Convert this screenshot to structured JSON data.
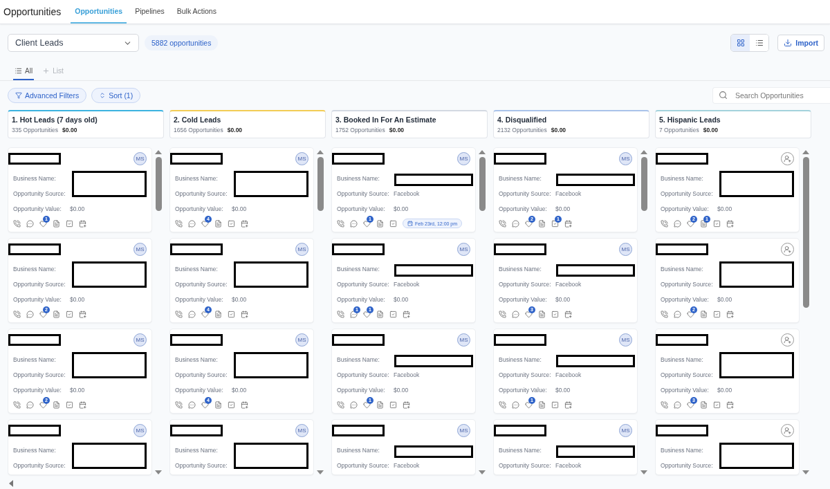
{
  "header": {
    "title": "Opportunities",
    "tabs": [
      {
        "label": "Opportunities",
        "selected": true
      },
      {
        "label": "Pipelines",
        "selected": false
      },
      {
        "label": "Bulk Actions",
        "selected": false
      }
    ]
  },
  "pipeline_select": {
    "value": "Client Leads"
  },
  "count_badge": "5882 opportunities",
  "view_toggle": [
    {
      "kind": "grid",
      "selected": true
    },
    {
      "kind": "list",
      "selected": false
    }
  ],
  "import_button": "Import",
  "list_tabs": [
    {
      "kind": "all",
      "label": "All",
      "selected": true
    },
    {
      "kind": "add",
      "label": "List",
      "selected": false
    }
  ],
  "filters": [
    {
      "kind": "filter",
      "label": "Advanced Filters"
    },
    {
      "kind": "sort",
      "label": "Sort (1)"
    }
  ],
  "search": {
    "placeholder": "Search Opportunities"
  },
  "columns": [
    {
      "title": "1. Hot Leads (7 days old)",
      "count": "335 Opportunities",
      "value": "$0.00",
      "color": "#3bb3e0",
      "cards": [
        {
          "avatar": {
            "kind": "initials",
            "text": "MS"
          },
          "fields": [
            {
              "label": "Business Name:"
            },
            {
              "label": "Opportunity Source:"
            },
            {
              "label": "Opportunity Value:",
              "value": "$0.00"
            }
          ],
          "badges": {
            "opportunity": "1"
          }
        },
        {
          "avatar": {
            "kind": "initials",
            "text": "MS"
          },
          "fields": [
            {
              "label": "Business Name:"
            },
            {
              "label": "Opportunity Source:"
            },
            {
              "label": "Opportunity Value:",
              "value": "$0.00"
            }
          ],
          "badges": {
            "opportunity": "2"
          }
        },
        {
          "avatar": {
            "kind": "initials",
            "text": "MS"
          },
          "fields": [
            {
              "label": "Business Name:"
            },
            {
              "label": "Opportunity Source:"
            },
            {
              "label": "Opportunity Value:",
              "value": "$0.00"
            }
          ],
          "badges": {
            "opportunity": "2"
          }
        },
        {
          "avatar": {
            "kind": "initials",
            "text": "MS"
          },
          "fields": [
            {
              "label": "Business Name:"
            },
            {
              "label": "Opportunity Source:"
            }
          ]
        }
      ]
    },
    {
      "title": "2. Cold Leads",
      "count": "1656 Opportunities",
      "value": "$0.00",
      "color": "#f2cc55",
      "cards": [
        {
          "avatar": {
            "kind": "initials",
            "text": "MS"
          },
          "fields": [
            {
              "label": "Business Name:"
            },
            {
              "label": "Opportunity Source:"
            },
            {
              "label": "Opportunity Value:",
              "value": "$0.00"
            }
          ],
          "badges": {
            "opportunity": "4"
          }
        },
        {
          "avatar": {
            "kind": "initials",
            "text": "MS"
          },
          "fields": [
            {
              "label": "Business Name:"
            },
            {
              "label": "Opportunity Source:"
            },
            {
              "label": "Opportunity Value:",
              "value": "$0.00"
            }
          ],
          "badges": {
            "opportunity": "4"
          }
        },
        {
          "avatar": {
            "kind": "initials",
            "text": "MS"
          },
          "fields": [
            {
              "label": "Business Name:"
            },
            {
              "label": "Opportunity Source:"
            },
            {
              "label": "Opportunity Value:",
              "value": "$0.00"
            }
          ],
          "badges": {
            "opportunity": "4"
          }
        },
        {
          "avatar": {
            "kind": "initials",
            "text": "MS"
          },
          "fields": [
            {
              "label": "Business Name:"
            },
            {
              "label": "Opportunity Source:"
            }
          ]
        }
      ]
    },
    {
      "title": "3. Booked In For An Estimate",
      "count": "1752 Opportunities",
      "value": "$0.00",
      "color": "#d3d9e2",
      "cards": [
        {
          "avatar": {
            "kind": "initials",
            "text": "MS"
          },
          "fields": [
            {
              "label": "Business Name:"
            },
            {
              "label": "Opportunity Source:",
              "value": "Facebook"
            },
            {
              "label": "Opportunity Value:",
              "value": "$0.00"
            }
          ],
          "badges": {
            "opportunity": "1"
          },
          "appointment": "Feb 23rd, 12:00 pm"
        },
        {
          "avatar": {
            "kind": "initials",
            "text": "MS"
          },
          "fields": [
            {
              "label": "Business Name:"
            },
            {
              "label": "Opportunity Source:",
              "value": "Facebook"
            },
            {
              "label": "Opportunity Value:",
              "value": "$0.00"
            }
          ],
          "badges": {
            "sms": "1",
            "opportunity": "1"
          }
        },
        {
          "avatar": {
            "kind": "initials",
            "text": "MS"
          },
          "fields": [
            {
              "label": "Business Name:"
            },
            {
              "label": "Opportunity Source:",
              "value": "Facebook"
            },
            {
              "label": "Opportunity Value:",
              "value": "$0.00"
            }
          ],
          "badges": {
            "opportunity": "1"
          }
        },
        {
          "avatar": {
            "kind": "initials",
            "text": "MS"
          },
          "fields": [
            {
              "label": "Business Name:"
            },
            {
              "label": "Opportunity Source:",
              "value": "Facebook"
            }
          ]
        }
      ]
    },
    {
      "title": "4. Disqualified",
      "count": "2132 Opportunities",
      "value": "$0.00",
      "color": "#a9c2ea",
      "cards": [
        {
          "avatar": {
            "kind": "initials",
            "text": "MS"
          },
          "fields": [
            {
              "label": "Business Name:"
            },
            {
              "label": "Opportunity Source:",
              "value": "Facebook"
            },
            {
              "label": "Opportunity Value:",
              "value": "$0.00"
            }
          ],
          "badges": {
            "opportunity": "2",
            "task": "1"
          }
        },
        {
          "avatar": {
            "kind": "initials",
            "text": "MS"
          },
          "fields": [
            {
              "label": "Business Name:"
            },
            {
              "label": "Opportunity Source:",
              "value": "Facebook"
            },
            {
              "label": "Opportunity Value:",
              "value": "$0.00"
            }
          ],
          "badges": {
            "opportunity": "3"
          }
        },
        {
          "avatar": {
            "kind": "initials",
            "text": "MS"
          },
          "fields": [
            {
              "label": "Business Name:"
            },
            {
              "label": "Opportunity Source:",
              "value": "Facebook"
            },
            {
              "label": "Opportunity Value:",
              "value": "$0.00"
            }
          ],
          "badges": {
            "opportunity": "1"
          }
        },
        {
          "avatar": {
            "kind": "initials",
            "text": "MS"
          },
          "fields": [
            {
              "label": "Business Name:"
            },
            {
              "label": "Opportunity Source:",
              "value": "Facebook"
            }
          ]
        }
      ]
    },
    {
      "title": "5. Hispanic Leads",
      "count": "7 Opportunities",
      "value": "$0.00",
      "color": "#a3d2dc",
      "cards": [
        {
          "avatar": {
            "kind": "unassigned"
          },
          "fields": [
            {
              "label": "Business Name:"
            },
            {
              "label": "Opportunity Source:"
            },
            {
              "label": "Opportunity Value:",
              "value": "$0.00"
            }
          ],
          "badges": {
            "opportunity": "2",
            "note": "1"
          }
        },
        {
          "avatar": {
            "kind": "unassigned"
          },
          "fields": [
            {
              "label": "Business Name:"
            },
            {
              "label": "Opportunity Source:"
            },
            {
              "label": "Opportunity Value:",
              "value": "$0.00"
            }
          ],
          "badges": {
            "opportunity": "2"
          }
        },
        {
          "avatar": {
            "kind": "unassigned"
          },
          "fields": [
            {
              "label": "Business Name:"
            },
            {
              "label": "Opportunity Source:"
            },
            {
              "label": "Opportunity Value:",
              "value": "$0.00"
            }
          ],
          "badges": {
            "opportunity": "3"
          }
        },
        {
          "avatar": {
            "kind": "unassigned"
          },
          "fields": [
            {
              "label": "Business Name:"
            },
            {
              "label": "Opportunity Source:"
            }
          ]
        }
      ]
    }
  ]
}
